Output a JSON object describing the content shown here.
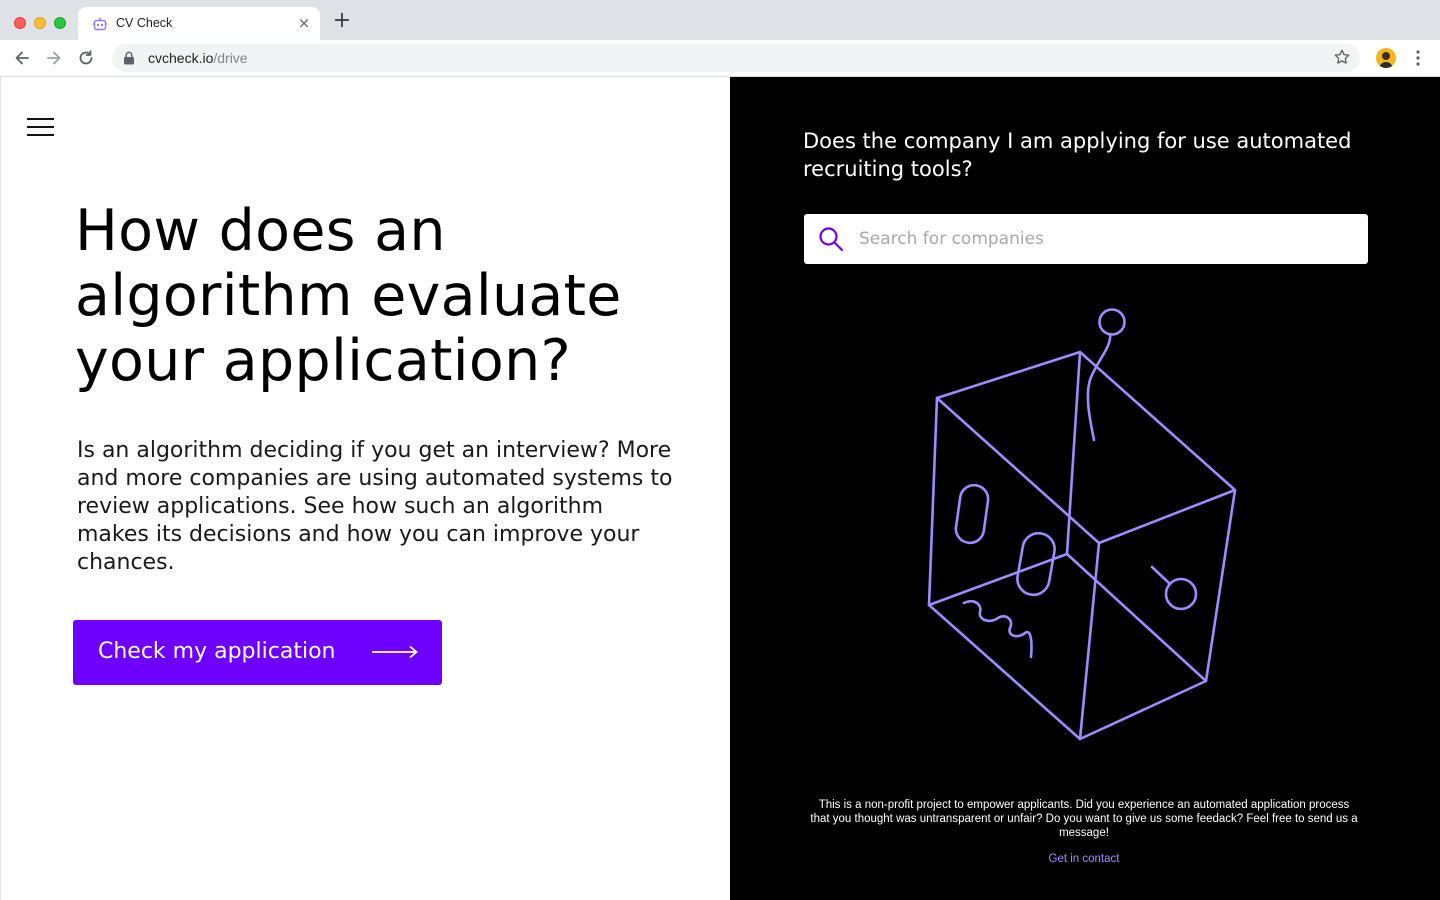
{
  "browser": {
    "tab_title": "CV Check",
    "tab_close": "×",
    "new_tab": "+",
    "url_domain": "cvcheck.io",
    "url_path": "/drive"
  },
  "hero": {
    "headline": "How does an algorithm evaluate your application?",
    "intro": "Is an algorithm deciding if you get an interview? More and more companies are using automated systems to review applications. See how such an algorithm makes its decisions and how you can improve your chances.",
    "cta_label": "Check my application"
  },
  "sidebar": {
    "question": "Does the company I am applying for use automated recruiting tools?",
    "search_placeholder": "Search for companies",
    "footnote": "This is a non-profit project to empower applicants. Did you experience an automated application process that you thought was untransparent or unfair? Do you want to give us some feedack? Feel free to send us a message!",
    "contact_link": "Get in contact"
  },
  "colors": {
    "accent": "#6e00ff",
    "illustration_stroke": "#9d8cff",
    "dark_panel": "#000000",
    "link": "#9d8cff"
  },
  "icons": {
    "menu": "hamburger-icon",
    "search": "search-icon",
    "cta_arrow": "long-arrow-right-icon",
    "illustration": "wireframe-box-illustration"
  }
}
